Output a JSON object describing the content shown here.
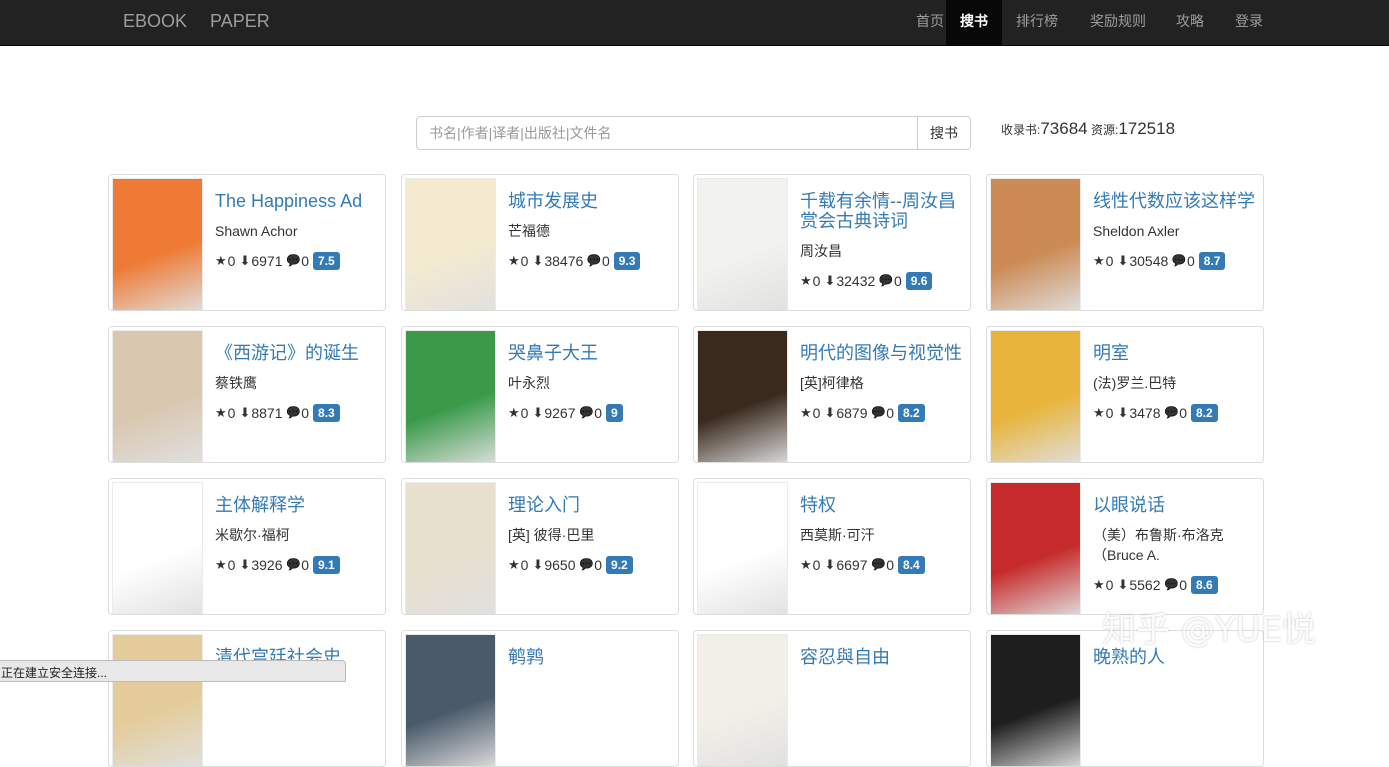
{
  "navbar": {
    "brand": [
      "EBOOK",
      "PAPER"
    ],
    "items": [
      {
        "label": "首页",
        "active": false
      },
      {
        "label": "搜书",
        "active": true
      },
      {
        "label": "排行榜",
        "active": false
      },
      {
        "label": "奖励规则",
        "active": false
      },
      {
        "label": "攻略",
        "active": false
      },
      {
        "label": "登录",
        "active": false
      }
    ]
  },
  "search": {
    "placeholder": "书名|作者|译者|出版社|文件名",
    "value": "",
    "button_label": "搜书"
  },
  "stats": {
    "books_label": "收录书:",
    "books_count": "73684",
    "resources_label": "资源:",
    "resources_count": "172518"
  },
  "books": [
    {
      "title": "The Happiness Ad",
      "author": "Shawn Achor",
      "stars": "0",
      "downloads": "6971",
      "comments": "0",
      "rating": "7.5",
      "cover_color": "#ef7a35"
    },
    {
      "title": "城市发展史",
      "author": "芒福德",
      "stars": "0",
      "downloads": "38476",
      "comments": "0",
      "rating": "9.3",
      "cover_color": "#f3ead0"
    },
    {
      "title": "千载有余情--周汝昌赏会古典诗词",
      "author": "周汝昌",
      "stars": "0",
      "downloads": "32432",
      "comments": "0",
      "rating": "9.6",
      "cover_color": "#f2f2ee"
    },
    {
      "title": "线性代数应该这样学",
      "author": "Sheldon Axler",
      "stars": "0",
      "downloads": "30548",
      "comments": "0",
      "rating": "8.7",
      "cover_color": "#cc8a55"
    },
    {
      "title": "《西游记》的诞生",
      "author": "蔡铁鹰",
      "stars": "0",
      "downloads": "8871",
      "comments": "0",
      "rating": "8.3",
      "cover_color": "#d9c7b0"
    },
    {
      "title": "哭鼻子大王",
      "author": "叶永烈",
      "stars": "0",
      "downloads": "9267",
      "comments": "0",
      "rating": "9",
      "cover_color": "#3a9a4a"
    },
    {
      "title": "明代的图像与视觉性",
      "author": "[英]柯律格",
      "stars": "0",
      "downloads": "6879",
      "comments": "0",
      "rating": "8.2",
      "cover_color": "#3a2a1e"
    },
    {
      "title": "明室",
      "author": "(法)罗兰.巴特",
      "stars": "0",
      "downloads": "3478",
      "comments": "0",
      "rating": "8.2",
      "cover_color": "#e8b43c"
    },
    {
      "title": "主体解释学",
      "author": "米歇尔·福柯",
      "stars": "0",
      "downloads": "3926",
      "comments": "0",
      "rating": "9.1",
      "cover_color": "#ffffff"
    },
    {
      "title": "理论入门",
      "author": "[英] 彼得·巴里",
      "stars": "0",
      "downloads": "9650",
      "comments": "0",
      "rating": "9.2",
      "cover_color": "#e9e1cf"
    },
    {
      "title": "特权",
      "author": "西莫斯·可汗",
      "stars": "0",
      "downloads": "6697",
      "comments": "0",
      "rating": "8.4",
      "cover_color": "#ffffff"
    },
    {
      "title": "以眼说话",
      "author": "（美）布鲁斯·布洛克（Bruce A.",
      "stars": "0",
      "downloads": "5562",
      "comments": "0",
      "rating": "8.6",
      "cover_color": "#c62a2a"
    },
    {
      "title": "清代宫廷社会史",
      "author": "",
      "stars": "",
      "downloads": "",
      "comments": "",
      "rating": "",
      "cover_color": "#e4cc9a"
    },
    {
      "title": "鹌鹑",
      "author": "",
      "stars": "",
      "downloads": "",
      "comments": "",
      "rating": "",
      "cover_color": "#4a5a6a"
    },
    {
      "title": "容忍與自由",
      "author": "",
      "stars": "",
      "downloads": "",
      "comments": "",
      "rating": "",
      "cover_color": "#f2efe8"
    },
    {
      "title": "晚熟的人",
      "author": "",
      "stars": "",
      "downloads": "",
      "comments": "",
      "rating": "",
      "cover_color": "#1e1e1e"
    }
  ],
  "icons": {
    "star": "★",
    "download": "⬇",
    "comment": "💬"
  },
  "status_bar": "正在建立安全连接...",
  "watermark": "知乎 @YUE悦"
}
